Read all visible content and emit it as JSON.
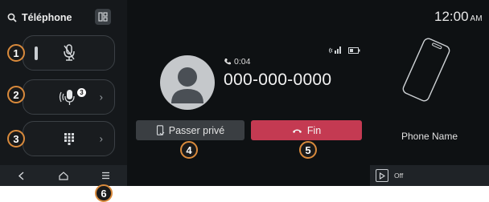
{
  "app": {
    "title": "Téléphone"
  },
  "clock": {
    "time": "12:00",
    "ampm": "AM"
  },
  "controls": [
    {
      "id": "mute",
      "badge": "1",
      "has_chevron": false
    },
    {
      "id": "mic_volume",
      "badge": "2",
      "has_chevron": true,
      "chevron": "›",
      "level": "3"
    },
    {
      "id": "keypad",
      "badge": "3",
      "has_chevron": true,
      "chevron": "›"
    }
  ],
  "call": {
    "timer": "0:04",
    "number": "000-000-0000",
    "private_label": "Passer privé",
    "end_label": "Fin",
    "private_badge": "4",
    "end_badge": "5"
  },
  "device": {
    "name": "Phone Name"
  },
  "player": {
    "label": "Off"
  },
  "navbar": {
    "back": "<",
    "home": "⌂",
    "menu": "≡",
    "menu_badge": "6"
  },
  "colors": {
    "end_button": "#c43a52",
    "callout_ring": "#d98a3c",
    "background": "#0e1113"
  }
}
